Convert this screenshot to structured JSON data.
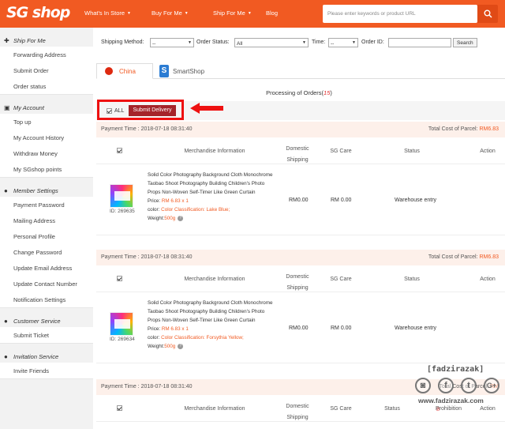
{
  "header": {
    "logo": "SG shop",
    "nav": [
      "What's In Store",
      "Buy For Me",
      "Ship For Me",
      "Blog"
    ],
    "search_placeholder": "Please enter keywords or product URL"
  },
  "sidebar": {
    "sections": [
      {
        "title": "Ship For Me",
        "icon": "plus-icon",
        "items": [
          "Forwarding Address",
          "Submit Order",
          "Order status"
        ]
      },
      {
        "title": "My Account",
        "icon": "card-icon",
        "items": [
          "Top up",
          "My Account History",
          "Withdraw Money",
          "My SGshop points"
        ]
      },
      {
        "title": "Member Settings",
        "icon": "user-icon",
        "items": [
          "Payment Password",
          "Mailing Address",
          "Personal Profile",
          "Change Password",
          "Update Email Address",
          "Update Contact Number",
          "Notification Settings"
        ]
      },
      {
        "title": "Customer Service",
        "icon": "chat-icon",
        "items": [
          "Submit Ticket"
        ]
      },
      {
        "title": "Invitation Service",
        "icon": "user-icon",
        "items": [
          "Invite Friends"
        ]
      }
    ]
  },
  "filters": {
    "shipping_method_label": "Shipping Method:",
    "shipping_method_value": "--",
    "order_status_label": "Order Status:",
    "order_status_value": "All",
    "time_label": "Time:",
    "time_value": "--",
    "order_id_label": "Order ID:",
    "search_button": "Search"
  },
  "tabs": [
    "China",
    "SmartShop"
  ],
  "processing": {
    "label": "Processing of Orders(",
    "count": "15",
    "close": ")"
  },
  "bulk": {
    "all_label": "ALL",
    "submit_label": "Submit Delivery"
  },
  "columns": [
    "Merchandise Information",
    "Domestic Shipping",
    "SG Care",
    "Status",
    "Action"
  ],
  "orders": [
    {
      "payment_time": "Payment Time : 2018-07-18 08:31:40",
      "total_label": "Total Cost of Parcel:",
      "total_value": "RM6.83",
      "id": "ID: 269635",
      "title": "Solid Color Photography Background Cloth Monochrome Taobao Shoot Photography Building Children's Photo Props Non-Woven Self-Timer Like Green Curtain",
      "price_label": "Price:",
      "price_value": "RM 6.83",
      "qty": "x 1",
      "color_label": "color:",
      "color_value": "Color Classification: Lake Blue;",
      "weight_label": "Weight:",
      "weight_value": "500g",
      "domestic_shipping": "RM0.00",
      "sg_care": "RM 0.00",
      "status": "Warehouse entry",
      "action": ""
    },
    {
      "payment_time": "Payment Time : 2018-07-18 08:31:40",
      "total_label": "Total Cost of Parcel:",
      "total_value": "RM6.83",
      "id": "ID: 269634",
      "title": "Solid Color Photography Background Cloth Monochrome Taobao Shoot Photography Building Children's Photo Props Non-Woven Self-Timer Like Green Curtain",
      "price_label": "Price:",
      "price_value": "RM 6.83",
      "qty": "x 1",
      "color_label": "color:",
      "color_value": "Color Classification: Forsythia Yellow;",
      "weight_label": "Weight:",
      "weight_value": "500g",
      "domestic_shipping": "RM0.00",
      "sg_care": "RM 0.00",
      "status": "Warehouse entry",
      "action": ""
    },
    {
      "payment_time": "Payment Time : 2018-07-18 08:31:40",
      "total_label": "Total Cost of Parcel:",
      "total_value": "RM",
      "status": "Status",
      "action": "Prohibition"
    }
  ],
  "watermark": {
    "name": "[fadzirazak]",
    "site": "www.fadzirazak.com",
    "icons": [
      "camera-icon",
      "facebook-icon",
      "twitter-icon",
      "google-plus-icon"
    ]
  },
  "colors": {
    "brand": "#f15a22",
    "button": "#a5242a",
    "highlight": "#ee1111"
  }
}
